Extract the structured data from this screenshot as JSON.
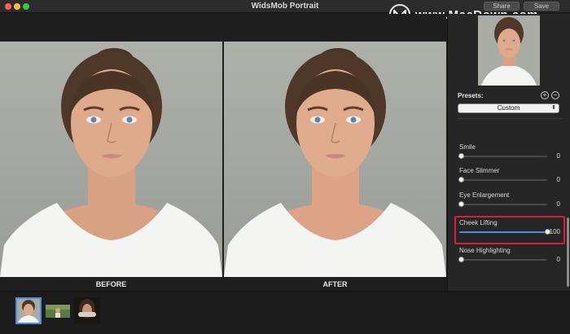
{
  "window": {
    "title": "WidsMob Portrait",
    "share_label": "Share",
    "save_label": "Save"
  },
  "watermark": {
    "text": "www.MacDown.com",
    "logo_letter": "M"
  },
  "canvas": {
    "before_label": "BEFORE",
    "after_label": "AFTER"
  },
  "sidebar": {
    "presets_label": "Presets:",
    "preset_selected": "Custom",
    "sliders": [
      {
        "label": "Smile",
        "value": "0",
        "level": 0
      },
      {
        "label": "Face Slimmer",
        "value": "0",
        "level": 0
      },
      {
        "label": "Eye Enlargement",
        "value": "0",
        "level": 0
      },
      {
        "label": "Cheek Lifting",
        "value": "100",
        "level": 1,
        "highlighted": true
      },
      {
        "label": "Nose Highlighting",
        "value": "0",
        "level": 0
      }
    ]
  },
  "colors": {
    "accent": "#4a8fe0",
    "highlight": "#d81e3a"
  }
}
